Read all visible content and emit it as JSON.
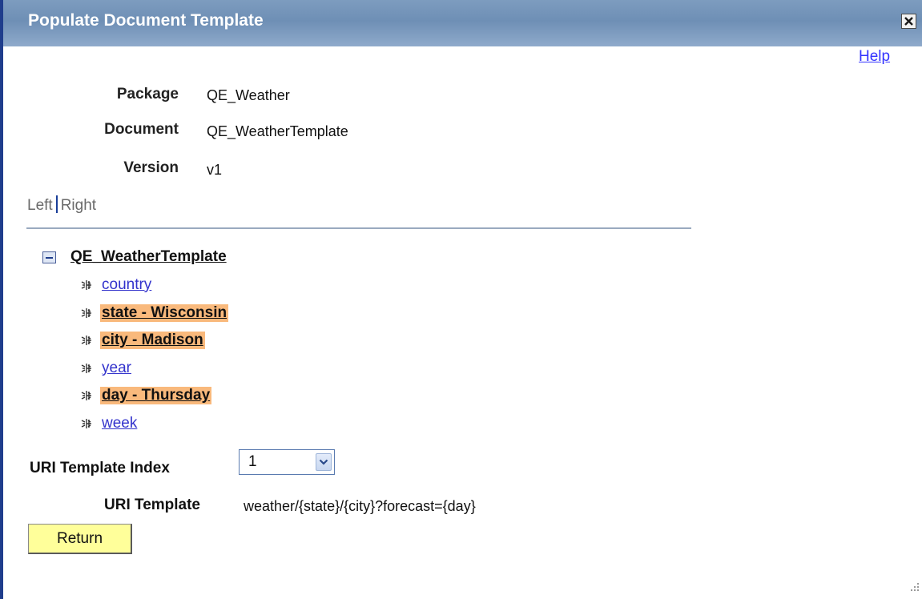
{
  "window": {
    "title": "Populate Document Template"
  },
  "help_link": "Help",
  "fields": {
    "package_label": "Package",
    "package_value": "QE_Weather",
    "document_label": "Document",
    "document_value": "QE_WeatherTemplate",
    "version_label": "Version",
    "version_value": "v1"
  },
  "view_toggle": {
    "left": "Left",
    "right": "Right"
  },
  "tree": {
    "root": "QE_WeatherTemplate",
    "items": [
      {
        "label": "country",
        "highlighted": false
      },
      {
        "label": "state - Wisconsin",
        "highlighted": true
      },
      {
        "label": "city - Madison",
        "highlighted": true
      },
      {
        "label": "year",
        "highlighted": false
      },
      {
        "label": "day - Thursday",
        "highlighted": true
      },
      {
        "label": "week",
        "highlighted": false
      }
    ]
  },
  "uri_template_index": {
    "label": "URI Template Index",
    "selected": "1"
  },
  "uri_template": {
    "label": "URI Template",
    "value": "weather/{state}/{city}?forecast={day}"
  },
  "return_button": "Return",
  "colors": {
    "titlebar": "#7d9cbf",
    "highlight": "#f9b97c",
    "link": "#3333cc",
    "button": "#ffff9a"
  },
  "icons": {
    "close": "close-x-icon",
    "collapse": "collapse-minus-icon",
    "tree_node": "tree-node-icon",
    "dropdown": "chevron-down-icon",
    "resize": "resize-grip-icon"
  }
}
